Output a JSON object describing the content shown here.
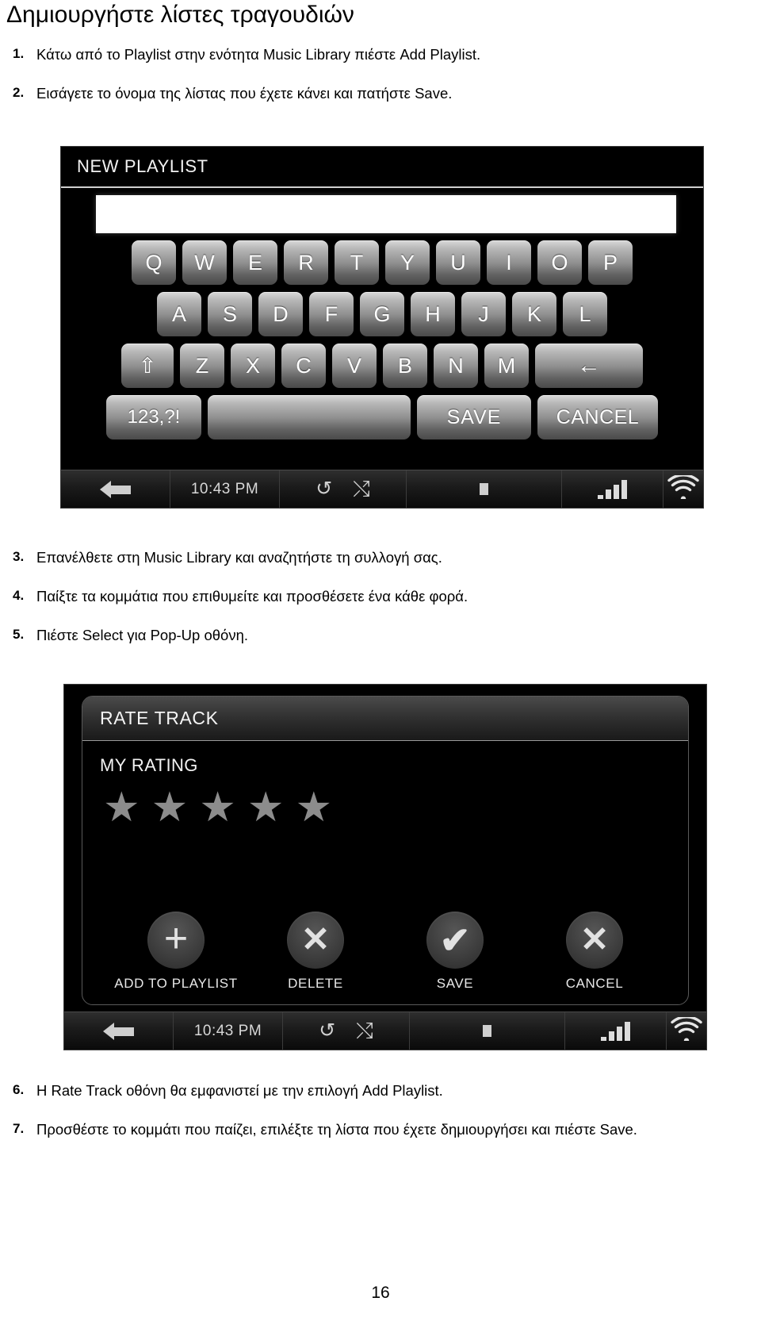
{
  "document": {
    "title": "Δημιουργήστε λίστες τραγουδιών",
    "page_number": "16",
    "steps_top": [
      {
        "num": "1.",
        "text": "Κάτω από το Playlist στην ενότητα Music Library πιέστε Add Playlist."
      },
      {
        "num": "2.",
        "text": "Εισάγετε το όνομα της λίστας που έχετε κάνει και πατήστε Save."
      }
    ],
    "steps_mid": [
      {
        "num": "3.",
        "text": "Επανέλθετε στη Music Library και αναζητήστε τη συλλογή σας."
      },
      {
        "num": "4.",
        "text": "Παίξτε τα κομμάτια που επιθυμείτε και προσθέσετε ένα κάθε φορά."
      },
      {
        "num": "5.",
        "text": "Πιέστε Select για Pop-Up οθόνη."
      }
    ],
    "steps_bottom": [
      {
        "num": "6.",
        "text": "Η Rate Track οθόνη θα εμφανιστεί με την επιλογή Add Playlist."
      },
      {
        "num": "7.",
        "text": "Προσθέστε το κομμάτι που παίζει, επιλέξτε τη λίστα που έχετε δημιουργήσει και πιέστε Save."
      }
    ]
  },
  "keyboard_screen": {
    "header_title": "NEW PLAYLIST",
    "text_input_value": "",
    "text_input_placeholder": "",
    "rows": {
      "row1": [
        "Q",
        "W",
        "E",
        "R",
        "T",
        "Y",
        "U",
        "I",
        "O",
        "P"
      ],
      "row2": [
        "A",
        "S",
        "D",
        "F",
        "G",
        "H",
        "J",
        "K",
        "L"
      ],
      "row3_shift": "⇧",
      "row3": [
        "Z",
        "X",
        "C",
        "V",
        "B",
        "N",
        "M"
      ],
      "row3_backspace": "←",
      "row4_numbers": "123,?!",
      "row4_space": "",
      "row4_save": "SAVE",
      "row4_cancel": "CANCEL"
    }
  },
  "rate_screen": {
    "header_title": "RATE TRACK",
    "subtitle": "MY RATING",
    "stars": [
      "★",
      "★",
      "★",
      "★",
      "★"
    ],
    "rating_value": 0,
    "actions": [
      {
        "glyph": "✛",
        "icon": "plus-icon",
        "label": "ADD TO PLAYLIST"
      },
      {
        "glyph": "✕",
        "icon": "x-icon",
        "label": "DELETE"
      },
      {
        "glyph": "✔",
        "icon": "check-icon",
        "label": "SAVE"
      },
      {
        "glyph": "✕",
        "icon": "x-icon",
        "label": "CANCEL"
      }
    ]
  },
  "status_bar": {
    "back_icon": "back-arrow-icon",
    "time": "10:43 PM",
    "repeat_icon": "↺",
    "shuffle_icon": "⤭",
    "stop_icon": "stop-square-icon",
    "volume_icon": "signal-bars-icon",
    "wifi_icon": "((·))"
  },
  "colors": {
    "page_background": "#ffffff",
    "screen_background": "#000000",
    "key_text": "#ffffff",
    "star_gray": "#8c8c8c",
    "status_text": "#d8d8d8"
  }
}
